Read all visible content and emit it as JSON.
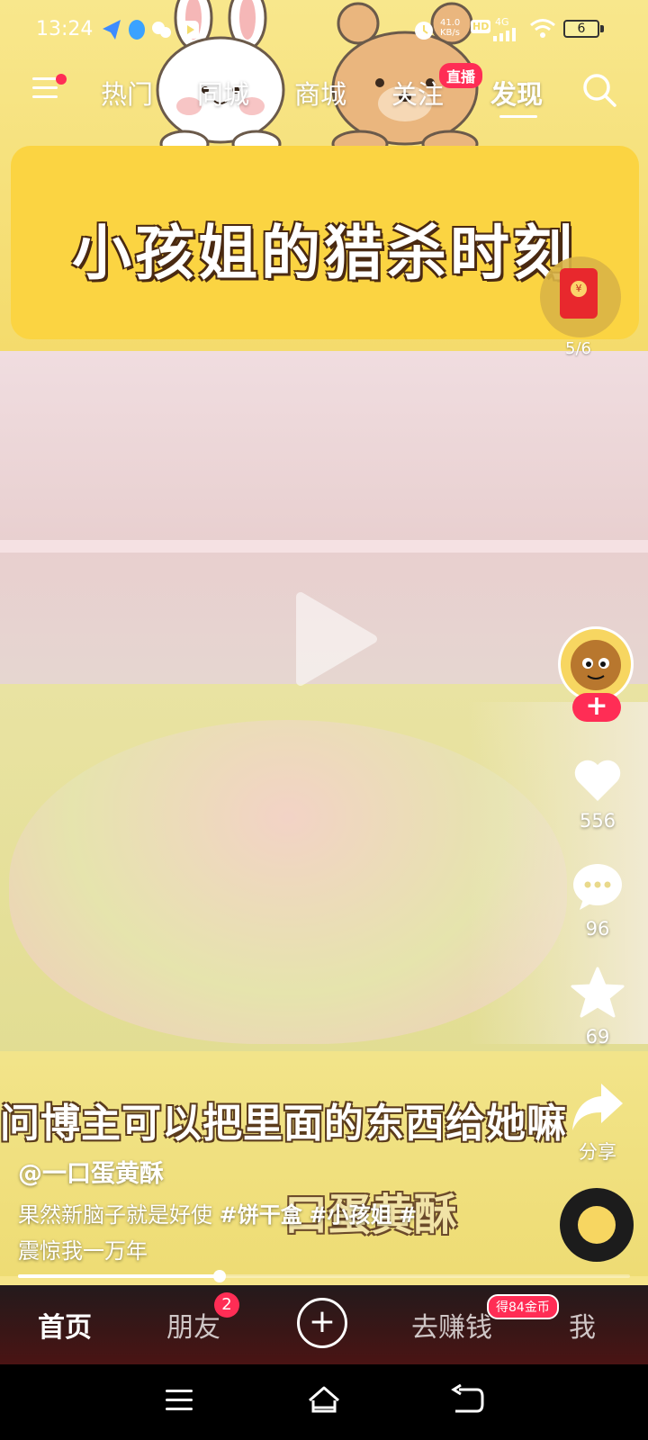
{
  "status_bar": {
    "time": "13:24",
    "net_speed_value": "41.0",
    "net_speed_unit": "KB/s",
    "hd": "HD",
    "network": "4G",
    "battery": "6"
  },
  "top_nav": {
    "tabs": [
      {
        "label": "热门",
        "active": false
      },
      {
        "label": "同城",
        "active": false
      },
      {
        "label": "商城",
        "active": false
      },
      {
        "label": "关注",
        "active": false,
        "badge": "直播"
      },
      {
        "label": "发现",
        "active": true
      }
    ]
  },
  "video": {
    "banner_title": "小孩姐的猎杀时刻",
    "subtitle": "问博主可以把里面的东西给她嘛",
    "watermark": "口蛋黄酥"
  },
  "red_packet": {
    "count": "5/6",
    "coin_symbol": "¥"
  },
  "actions": {
    "likes": "556",
    "comments": "96",
    "favorites": "69",
    "share": "分享",
    "follow_symbol": "+"
  },
  "caption": {
    "author": "@一口蛋黄酥",
    "text": "果然新脑子就是好使",
    "tags": [
      "#饼干盒",
      "#小孩姐",
      "#"
    ],
    "text_line2": "震惊我一万年"
  },
  "progress": {
    "fraction": 0.33
  },
  "bottom_nav": {
    "home": "首页",
    "friends": "朋友",
    "friends_badge": "2",
    "plus": "+",
    "earn": "去赚钱",
    "earn_badge": "得84金币",
    "me": "我"
  },
  "colors": {
    "accent": "#ff2d55",
    "banner_yellow": "#fbd442",
    "tabbar_dark": "#2a1a1a"
  }
}
